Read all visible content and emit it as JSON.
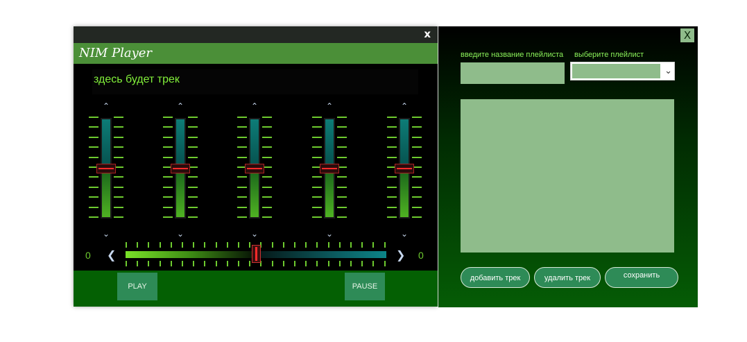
{
  "player": {
    "close_glyph": "x",
    "app_title": "NIM Player",
    "track_text": "здесь будет трек",
    "eq_bands": [
      {
        "level": 0.5
      },
      {
        "level": 0.5
      },
      {
        "level": 0.5
      },
      {
        "level": 0.5
      },
      {
        "level": 0.5
      }
    ],
    "seek": {
      "left_label": "0",
      "right_label": "0",
      "position": 0.5
    },
    "play_label": "PLAY",
    "pause_label": "PAUSE"
  },
  "playlist": {
    "close_glyph": "X",
    "name_label": "введите название плейлиста",
    "select_label": "выберите плейлист",
    "name_value": "",
    "selected_value": "",
    "buttons": {
      "add": "добавить трек",
      "delete": "удалить трек",
      "save": "сохранить"
    }
  },
  "colors": {
    "accent_green": "#4b8f38",
    "button_green": "#2e8b57",
    "field_green": "#8fbc8b",
    "text_lime": "#82f03a"
  }
}
